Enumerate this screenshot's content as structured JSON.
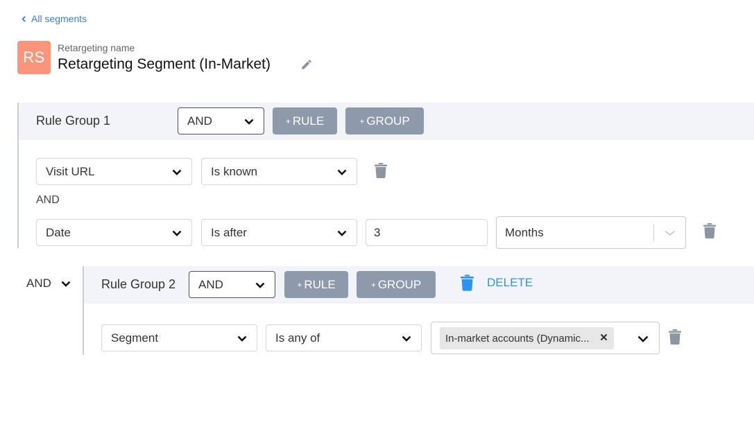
{
  "nav": {
    "back_label": "All segments"
  },
  "header": {
    "avatar_initials": "RS",
    "name_label": "Retargeting name",
    "name_value": "Retargeting Segment (In-Market)"
  },
  "colors": {
    "accent_blue": "#2e93f0",
    "link_blue": "#3b7fc4",
    "avatar_bg": "#f8957b",
    "button_gray": "#8c9aab",
    "group_header_bg": "#f3f4f8"
  },
  "groups": [
    {
      "title": "Rule Group 1",
      "operator": "AND",
      "add_rule_label": "RULE",
      "add_group_label": "GROUP",
      "rules": [
        {
          "field": "Visit URL",
          "condition": "Is known"
        },
        {
          "field": "Date",
          "condition": "Is after",
          "value": "3",
          "unit": "Months"
        }
      ],
      "joiner": "AND"
    },
    {
      "outer_operator": "AND",
      "title": "Rule Group 2",
      "operator": "AND",
      "add_rule_label": "RULE",
      "add_group_label": "GROUP",
      "delete_label": "DELETE",
      "rules": [
        {
          "field": "Segment",
          "condition": "Is any of",
          "selected": [
            "In-market accounts (Dynamic..."
          ]
        }
      ]
    }
  ],
  "icons": {
    "back": "chevron-left-icon",
    "edit": "pencil-icon",
    "dropdown": "chevron-down-icon",
    "delete": "trash-icon",
    "remove_chip": "close-icon"
  }
}
